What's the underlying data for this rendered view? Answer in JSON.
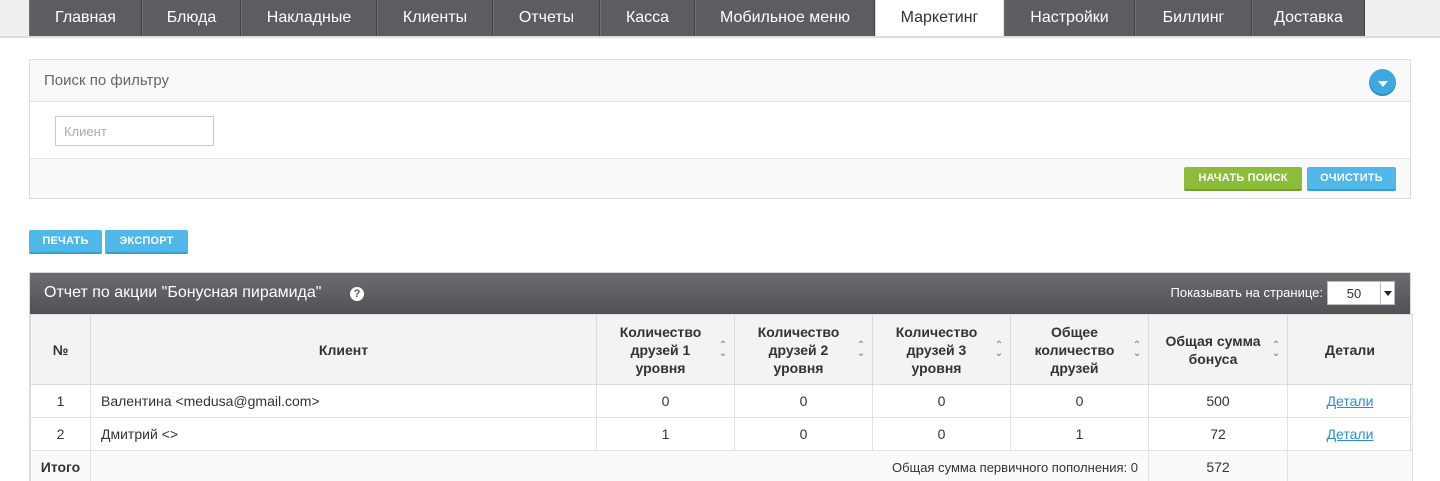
{
  "nav": {
    "tabs": [
      {
        "label": "Главная",
        "active": false
      },
      {
        "label": "Блюда",
        "active": false
      },
      {
        "label": "Накладные",
        "active": false
      },
      {
        "label": "Клиенты",
        "active": false
      },
      {
        "label": "Отчеты",
        "active": false
      },
      {
        "label": "Касса",
        "active": false
      },
      {
        "label": "Мобильное меню",
        "active": false
      },
      {
        "label": "Маркетинг",
        "active": true
      },
      {
        "label": "Настройки",
        "active": false
      },
      {
        "label": "Биллинг",
        "active": false
      },
      {
        "label": "Доставка",
        "active": false
      }
    ]
  },
  "filter": {
    "title": "Поиск по фильтру",
    "client_placeholder": "Клиент",
    "client_value": "",
    "search_button": "НАЧАТЬ ПОИСК",
    "clear_button": "ОЧИСТИТЬ"
  },
  "actions": {
    "print_button": "ПЕЧАТЬ",
    "export_button": "ЭКСПОРТ"
  },
  "report": {
    "title": "Отчет по акции \"Бонусная пирамида\"",
    "help_icon": "question-icon",
    "perpage_label": "Показывать на странице:",
    "perpage_value": "50",
    "columns": {
      "num": "№",
      "client": "Клиент",
      "friends_l1": "Количество друзей 1 уровня",
      "friends_l2": "Количество друзей 2 уровня",
      "friends_l3": "Количество друзей 3 уровня",
      "friends_total": "Общее количество друзей",
      "bonus_total": "Общая сумма бонуса",
      "details": "Детали"
    },
    "rows": [
      {
        "num": "1",
        "client": "Валентина <medusa@gmail.com>",
        "l1": "0",
        "l2": "0",
        "l3": "0",
        "total": "0",
        "bonus": "500",
        "details": "Детали"
      },
      {
        "num": "2",
        "client": "Дмитрий <>",
        "l1": "1",
        "l2": "0",
        "l3": "0",
        "total": "1",
        "bonus": "72",
        "details": "Детали"
      }
    ],
    "totals": {
      "label": "Итого",
      "initial_topup": "Общая сумма первичного пополнения: 0",
      "bonus_sum": "572"
    }
  }
}
